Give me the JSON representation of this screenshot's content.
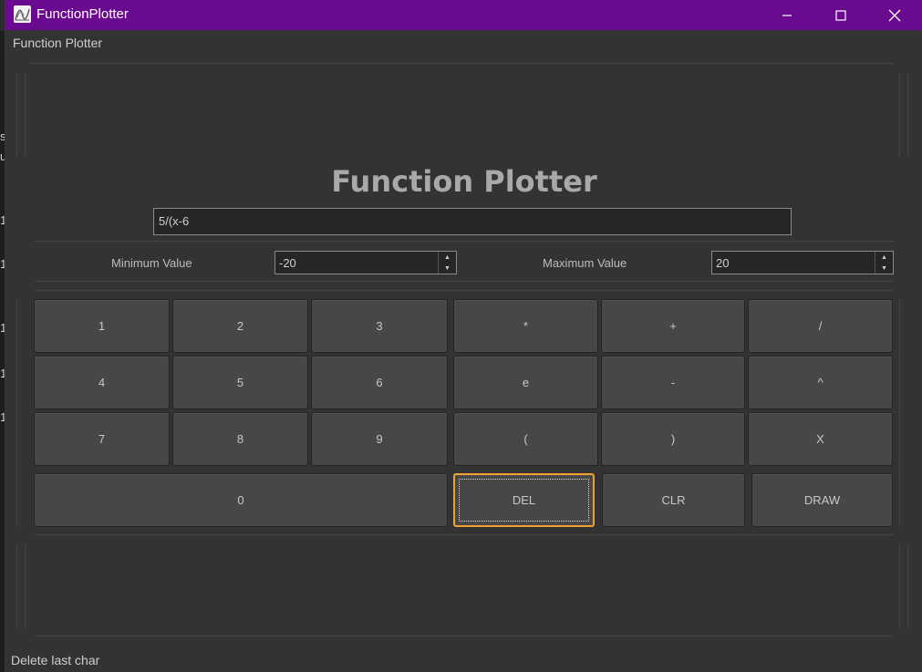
{
  "window": {
    "title": "FunctionPlotter",
    "menu_label": "Function Plotter",
    "heading": "Function Plotter",
    "status_text": "Delete last char"
  },
  "icons": {
    "app": "app-plot-icon",
    "minimize": "minimize-icon",
    "maximize": "maximize-icon",
    "close": "close-icon",
    "spin_up": "chevron-up-icon",
    "spin_down": "chevron-down-icon"
  },
  "expression": {
    "value": "5/(x-6"
  },
  "range": {
    "min_label": "Minimum Value",
    "min_value": "-20",
    "max_label": "Maximum Value",
    "max_value": "20"
  },
  "keys": {
    "k1": "1",
    "k2": "2",
    "k3": "3",
    "k4": "4",
    "k5": "5",
    "k6": "6",
    "k7": "7",
    "k8": "8",
    "k9": "9",
    "k0": "0",
    "mul": "*",
    "plus": "+",
    "div": "/",
    "e": "e",
    "minus": "-",
    "pow": "^",
    "lparen": "(",
    "rparen": ")",
    "x": "X",
    "del": "DEL",
    "clr": "CLR",
    "draw": "DRAW"
  },
  "colors": {
    "titlebar": "#6a0a8e",
    "background": "#333333",
    "focus_border": "#f0a030"
  }
}
